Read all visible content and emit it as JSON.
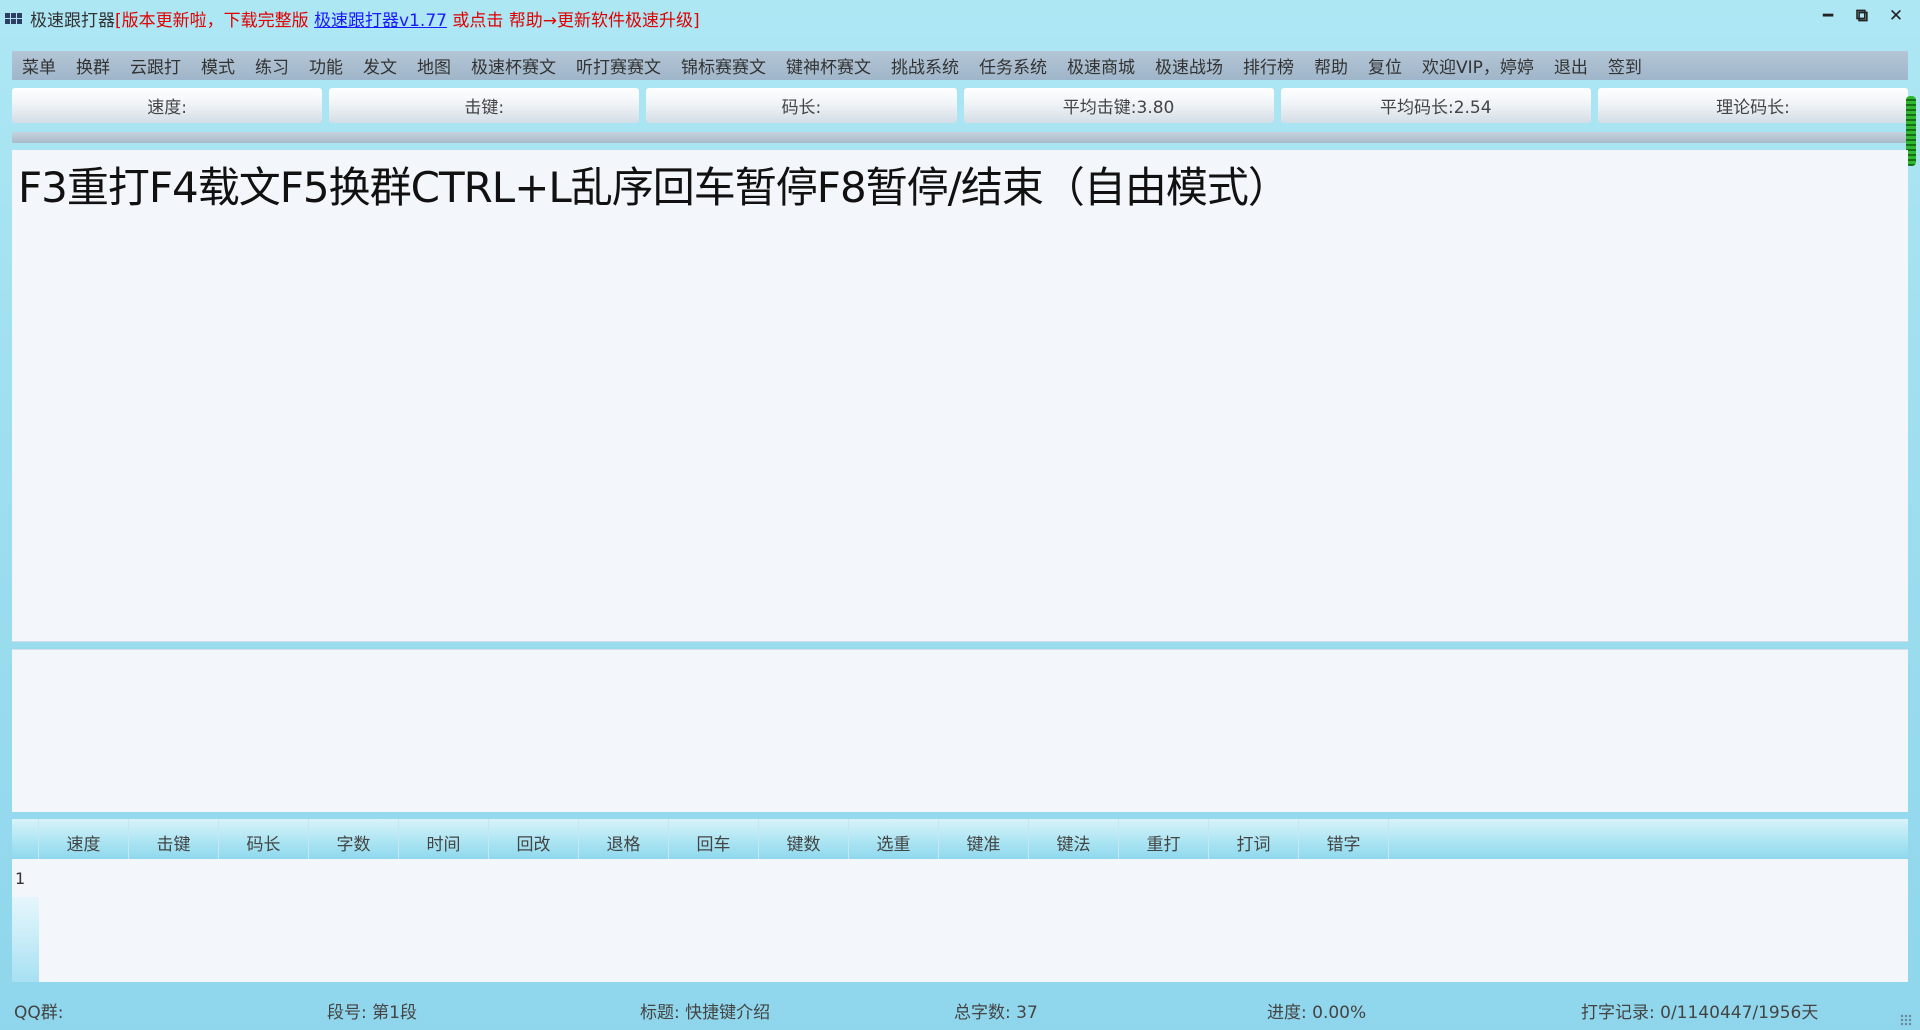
{
  "titlebar": {
    "app_name": "极速跟打器",
    "notice_prefix": "[版本更新啦，下载完整版 ",
    "link_text": "极速跟打器v1.77",
    "notice_suffix": " 或点击 帮助→更新软件极速升级]",
    "minimize_glyph": "━",
    "restore_glyph": "⧉",
    "close_glyph": "✕"
  },
  "menu": {
    "items": [
      "菜单",
      "换群",
      "云跟打",
      "模式",
      "练习",
      "功能",
      "发文",
      "地图",
      "极速杯赛文",
      "听打赛赛文",
      "锦标赛赛文",
      "键神杯赛文",
      "挑战系统",
      "任务系统",
      "极速商城",
      "极速战场",
      "排行榜",
      "帮助",
      "复位",
      "欢迎VIP，婷婷",
      "退出",
      "签到"
    ]
  },
  "stats": {
    "speed": "速度:",
    "keystroke": "击键:",
    "code_length": "码长:",
    "avg_keystroke": "平均击键:3.80",
    "avg_code_length": "平均码长:2.54",
    "theory_code_length": "理论码长:"
  },
  "text_panel": {
    "content": "F3重打F4载文F5换群CTRL+L乱序回车暂停F8暂停/结束（自由模式）"
  },
  "input_panel": {
    "value": ""
  },
  "table": {
    "columns": [
      "速度",
      "击键",
      "码长",
      "字数",
      "时间",
      "回改",
      "退格",
      "回车",
      "键数",
      "选重",
      "键准",
      "键法",
      "重打",
      "打词",
      "错字"
    ],
    "rows": [
      "1"
    ]
  },
  "status": {
    "qq_group": "QQ群:",
    "segment": "段号: 第1段",
    "title": "标题: 快捷键介绍",
    "total_chars": "总字数: 37",
    "progress": "进度: 0.00%",
    "record": "打字记录: 0/1140447/1956天"
  }
}
